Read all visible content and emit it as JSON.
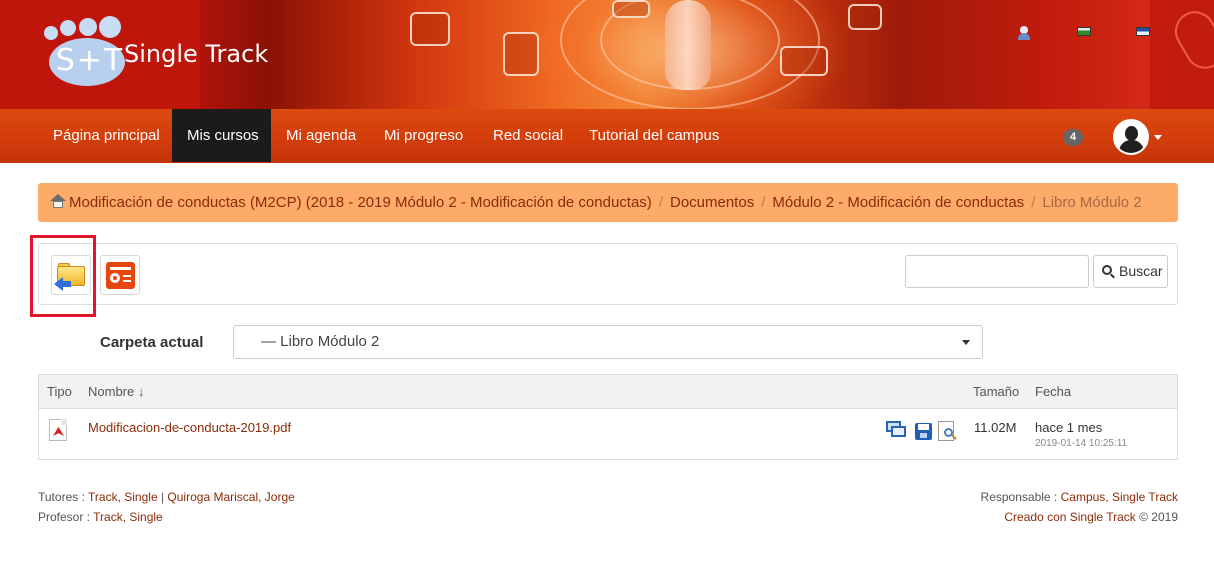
{
  "header": {
    "logo_initials": "S+T",
    "brand": "Single Track"
  },
  "nav": {
    "items": [
      {
        "label": "Página principal"
      },
      {
        "label": "Mis cursos"
      },
      {
        "label": "Mi agenda"
      },
      {
        "label": "Mi progreso"
      },
      {
        "label": "Red social"
      },
      {
        "label": "Tutorial del campus"
      }
    ],
    "active_index": 1,
    "notification_count": "4"
  },
  "breadcrumb": {
    "items": [
      "Modificación de conductas (M2CP) (2018 - 2019 Módulo 2 - Modificación de conductas)",
      "Documentos",
      "Módulo 2 - Modificación de conductas",
      "Libro Módulo 2"
    ],
    "separator": "/"
  },
  "toolbar": {
    "search_placeholder": "",
    "search_button": "Buscar"
  },
  "folder": {
    "label": "Carpeta actual",
    "selected": "— Libro Módulo 2"
  },
  "table": {
    "headers": {
      "type": "Tipo",
      "name": "Nombre ↓",
      "size": "Tamaño",
      "date": "Fecha"
    },
    "rows": [
      {
        "name": "Modificacion-de-conducta-2019.pdf",
        "size": "11.02M",
        "date_relative": "hace 1 mes",
        "date_exact": "2019-01-14 10:25:11"
      }
    ]
  },
  "footer": {
    "tutores_label": "Tutores : ",
    "tutores": [
      "Track, Single",
      "Quiroga Mariscal, Jorge"
    ],
    "tutores_sep": " | ",
    "profesor_label": "Profesor : ",
    "profesor": "Track, Single",
    "responsable_label": "Responsable : ",
    "responsable": "Campus, Single Track",
    "creado": "Creado con Single Track",
    "copyright": " © 2019"
  },
  "colors": {
    "navbar": "#d23c0b",
    "breadcrumb_bg": "#fcab69",
    "link": "#8a2c0a",
    "highlight": "#e0142d"
  }
}
